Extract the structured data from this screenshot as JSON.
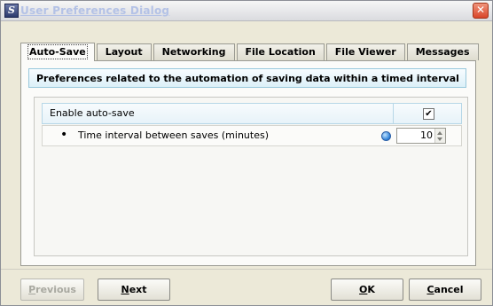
{
  "window": {
    "app_icon_glyph": "S",
    "title": "User Preferences Dialog",
    "close_glyph": "✕"
  },
  "tabs": [
    {
      "label": "Auto-Save",
      "active": true
    },
    {
      "label": "Layout"
    },
    {
      "label": "Networking"
    },
    {
      "label": "File Location"
    },
    {
      "label": "File Viewer"
    },
    {
      "label": "Messages"
    }
  ],
  "panel": {
    "header": "Preferences related to the automation of saving data within a timed interval",
    "enable_autosave": {
      "label": "Enable auto-save",
      "checked": true,
      "check_glyph": "✔"
    },
    "interval": {
      "bullet": "•",
      "label": "Time interval between saves (minutes)",
      "value": "10"
    }
  },
  "buttons": {
    "previous": {
      "mnemonic": "P",
      "rest": "revious",
      "enabled": false
    },
    "next": {
      "mnemonic": "N",
      "rest": "ext"
    },
    "ok": {
      "mnemonic": "O",
      "rest": "K"
    },
    "cancel": {
      "mnemonic": "C",
      "rest": "ancel"
    }
  }
}
